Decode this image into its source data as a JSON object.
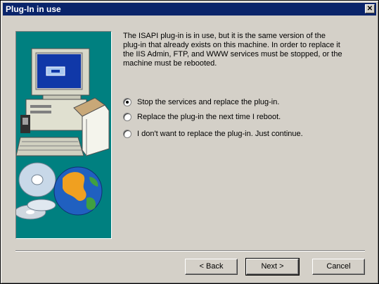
{
  "window": {
    "title": "Plug-In in use",
    "close_glyph": "✕"
  },
  "message": "The ISAPI plug-in is in use, but it is the same version of the\nplug-in that already exists on this machine.  In order to replace it\nthe IIS Admin, FTP, and WWW services must be stopped, or the\nmachine must be rebooted.",
  "options": [
    {
      "label": "Stop the services and replace the plug-in.",
      "selected": true
    },
    {
      "label": "Replace the plug-in the next time I reboot.",
      "selected": false
    },
    {
      "label": "I don't want to replace the plug-in.  Just continue.",
      "selected": false
    }
  ],
  "buttons": {
    "back": "< Back",
    "next": "Next >",
    "cancel": "Cancel"
  },
  "colors": {
    "titlebar": "#0a246a",
    "panel": "#008080",
    "face": "#d4d0c8"
  }
}
